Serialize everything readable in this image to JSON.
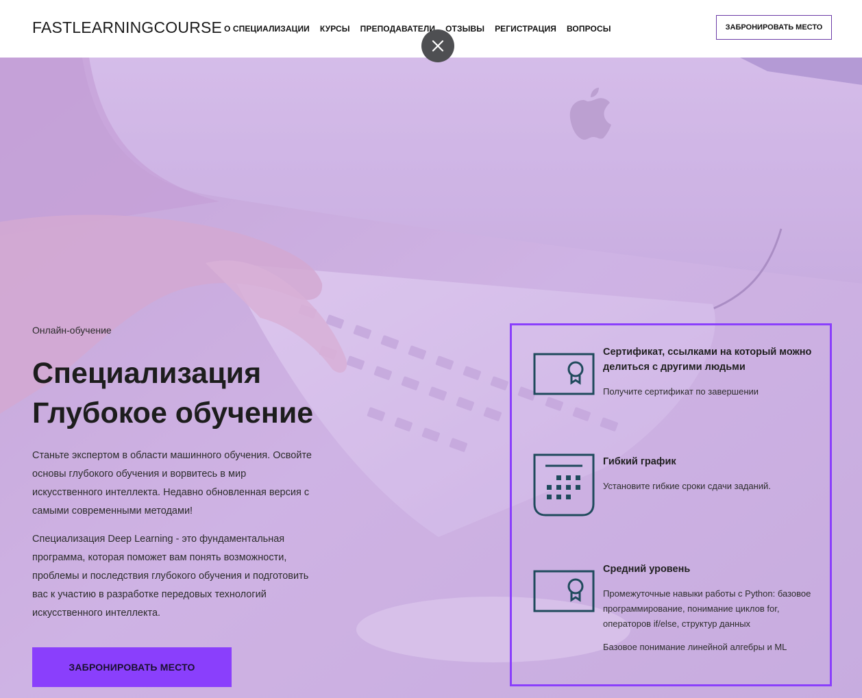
{
  "header": {
    "logo": "FASTLEARNINGCOURSE",
    "nav": [
      "О СПЕЦИАЛИЗАЦИИ",
      "КУРСЫ",
      "ПРЕПОДАВАТЕЛИ",
      "ОТЗЫВЫ",
      "РЕГИСТРАЦИЯ",
      "ВОПРОСЫ"
    ],
    "cta": "ЗАБРОНИРОВАТЬ МЕСТО",
    "close_icon": "close-icon"
  },
  "hero": {
    "eyebrow": "Онлайн-обучение",
    "title_line1": "Специализация",
    "title_line2": "Глубокое обучение",
    "para1": "Станьте экспертом в области машинного обучения. Освойте основы глубокого обучения и ворвитесь в мир искусственного интеллекта. Недавно обновленная версия с самыми современными методами!",
    "para2": "Специализация Deep Learning - это фундаментальная программа, которая поможет вам понять возможности, проблемы и последствия глубокого обучения и подготовить вас к участию в разработке передовых технологий искусственного интеллекта.",
    "cta": "ЗАБРОНИРОВАТЬ МЕСТО"
  },
  "features": [
    {
      "icon": "certificate-icon",
      "title": "Сертификат, ссылками на который можно делиться с другими людьми",
      "desc": "Получите сертификат по завершении",
      "desc2": ""
    },
    {
      "icon": "calendar-icon",
      "title": "Гибкий график",
      "desc": "Установите гибкие сроки сдачи заданий.",
      "desc2": ""
    },
    {
      "icon": "certificate-icon",
      "title": "Средний уровень",
      "desc": "Промежуточные навыки работы с Python: базовое программирование, понимание циклов for, операторов if/else, структур данных",
      "desc2": "Базовое понимание линейной алгебры и ML"
    }
  ],
  "colors": {
    "accent": "#8a3ffc",
    "overlay": "#c8a8e6",
    "icon": "#1f4a5c",
    "close_bg": "#4e4f52"
  }
}
